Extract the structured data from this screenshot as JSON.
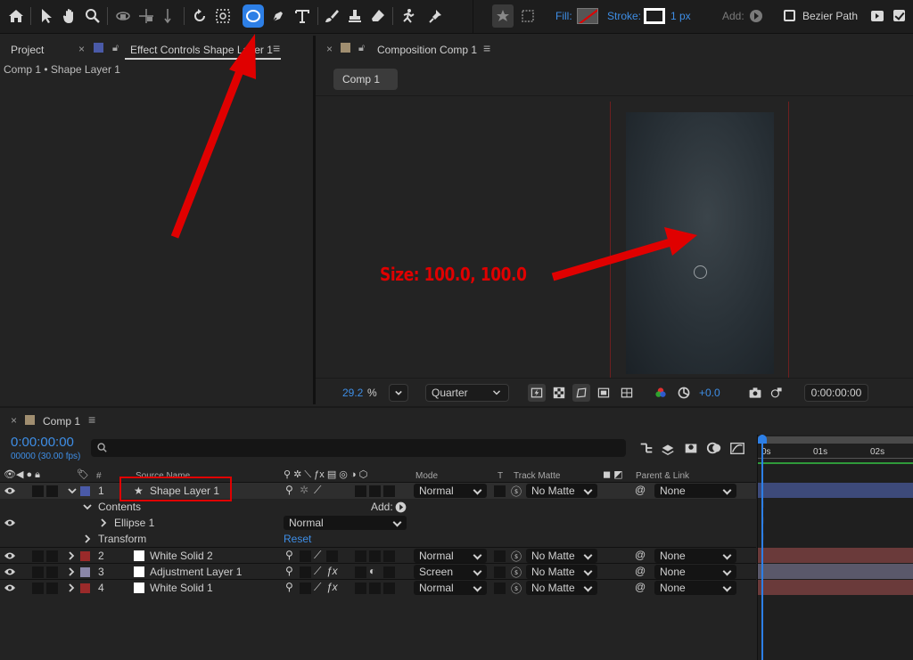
{
  "toolbar": {
    "fill_label": "Fill:",
    "stroke_label": "Stroke:",
    "stroke_width": "1 px",
    "add_label": "Add:",
    "bezier_label": "Bezier Path",
    "bezier_checked": false
  },
  "project_panel": {
    "project_tab": "Project",
    "effect_tab": "Effect Controls Shape Layer 1",
    "breadcrumb": "Comp 1 • Shape Layer 1"
  },
  "composition_panel": {
    "tab": "Composition Comp 1",
    "comp_button": "Comp 1"
  },
  "viewer_footer": {
    "zoom": "29.2",
    "zoom_unit": "%",
    "resolution": "Quarter",
    "exposure": "+0.0",
    "timecode": "0:00:00:00"
  },
  "timeline": {
    "tab": "Comp 1",
    "current_time": "0:00:00:00",
    "frame_info": "00000 (30.00 fps)",
    "headers": {
      "number": "#",
      "source_name": "Source Name",
      "mode": "Mode",
      "t": "T",
      "track_matte": "Track Matte",
      "parent_link": "Parent & Link"
    },
    "ruler": [
      "0s",
      "01s",
      "02s"
    ],
    "layers": [
      {
        "index": "1",
        "name": "Shape Layer 1",
        "mode": "Normal",
        "matte": "No Matte",
        "parent": "None",
        "label_color": "#4a5aa8"
      },
      {
        "index": "2",
        "name": "White Solid 2",
        "mode": "Normal",
        "matte": "No Matte",
        "parent": "None",
        "label_color": "#9a2a2a"
      },
      {
        "index": "3",
        "name": "Adjustment Layer 1",
        "mode": "Screen",
        "matte": "No Matte",
        "parent": "None",
        "label_color": "#8a86a8"
      },
      {
        "index": "4",
        "name": "White Solid 1",
        "mode": "Normal",
        "matte": "No Matte",
        "parent": "None",
        "label_color": "#9a2a2a"
      }
    ],
    "contents_label": "Contents",
    "contents_add": "Add:",
    "ellipse_label": "Ellipse 1",
    "ellipse_mode": "Normal",
    "transform_label": "Transform",
    "transform_reset": "Reset"
  },
  "annotation": {
    "size_text": "Size: 100.0, 100.0"
  },
  "colors": {
    "accent": "#2d7fe6",
    "annotation_red": "#e00000",
    "timecode_blue": "#3e8ee6"
  }
}
